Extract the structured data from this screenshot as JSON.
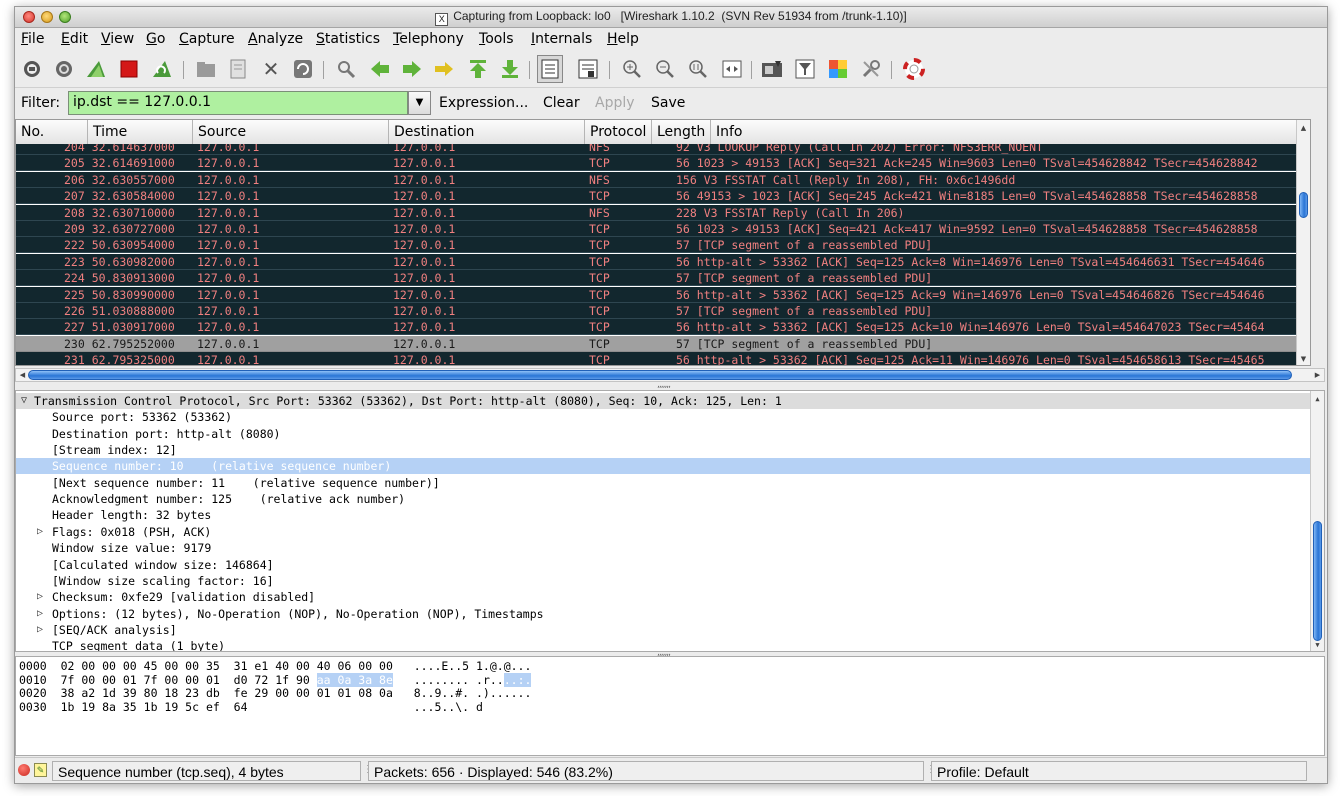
{
  "window": {
    "title": "Capturing from Loopback: lo0   [Wireshark 1.10.2  (SVN Rev 51934 from /trunk-1.10)]",
    "x11_glyph": "X"
  },
  "menu": [
    "File",
    "Edit",
    "View",
    "Go",
    "Capture",
    "Analyze",
    "Statistics",
    "Telephony",
    "Tools",
    "Internals",
    "Help"
  ],
  "toolbar": {
    "icons": [
      "interface-list-icon",
      "capture-options-icon",
      "start-capture-icon",
      "stop-capture-icon",
      "restart-capture-icon",
      "open-file-icon",
      "save-file-icon",
      "close-file-icon",
      "reload-icon",
      "find-packet-icon",
      "go-back-icon",
      "go-forward-icon",
      "go-to-packet-icon",
      "first-packet-icon",
      "last-packet-icon",
      "colorize-icon",
      "auto-scroll-icon",
      "zoom-in-icon",
      "zoom-out-icon",
      "normal-size-icon",
      "resize-columns-icon",
      "capture-filters-icon",
      "display-filters-icon",
      "coloring-rules-icon",
      "preferences-icon",
      "help-icon"
    ]
  },
  "filter": {
    "label": "Filter:",
    "value": "ip.dst == 127.0.0.1",
    "expression": "Expression...",
    "clear": "Clear",
    "apply": "Apply",
    "save": "Save"
  },
  "packet_list": {
    "columns": [
      "No.",
      "Time",
      "Source",
      "Destination",
      "Protocol",
      "Length",
      "Info"
    ],
    "rows": [
      {
        "no": "204",
        "time": "32.614637000",
        "src": "127.0.0.1",
        "dst": "127.0.0.1",
        "proto": "NFS",
        "len": "92",
        "info": "V3 LOOKUP Reply (Call In 202) Error: NFS3ERR_NOENT"
      },
      {
        "no": "205",
        "time": "32.614691000",
        "src": "127.0.0.1",
        "dst": "127.0.0.1",
        "proto": "TCP",
        "len": "56",
        "info": "1023 > 49153 [ACK] Seq=321 Ack=245 Win=9603 Len=0 TSval=454628842 TSecr=454628842"
      },
      {
        "no": "206",
        "time": "32.630557000",
        "src": "127.0.0.1",
        "dst": "127.0.0.1",
        "proto": "NFS",
        "len": "156",
        "info": "V3 FSSTAT Call (Reply In 208), FH: 0x6c1496dd"
      },
      {
        "no": "207",
        "time": "32.630584000",
        "src": "127.0.0.1",
        "dst": "127.0.0.1",
        "proto": "TCP",
        "len": "56",
        "info": "49153 > 1023 [ACK] Seq=245 Ack=421 Win=8185 Len=0 TSval=454628858 TSecr=454628858"
      },
      {
        "no": "208",
        "time": "32.630710000",
        "src": "127.0.0.1",
        "dst": "127.0.0.1",
        "proto": "NFS",
        "len": "228",
        "info": "V3 FSSTAT Reply (Call In 206)"
      },
      {
        "no": "209",
        "time": "32.630727000",
        "src": "127.0.0.1",
        "dst": "127.0.0.1",
        "proto": "TCP",
        "len": "56",
        "info": "1023 > 49153 [ACK] Seq=421 Ack=417 Win=9592 Len=0 TSval=454628858 TSecr=454628858"
      },
      {
        "no": "222",
        "time": "50.630954000",
        "src": "127.0.0.1",
        "dst": "127.0.0.1",
        "proto": "TCP",
        "len": "57",
        "info": "[TCP segment of a reassembled PDU]"
      },
      {
        "no": "223",
        "time": "50.630982000",
        "src": "127.0.0.1",
        "dst": "127.0.0.1",
        "proto": "TCP",
        "len": "56",
        "info": "http-alt > 53362 [ACK] Seq=125 Ack=8 Win=146976 Len=0 TSval=454646631 TSecr=454646"
      },
      {
        "no": "224",
        "time": "50.830913000",
        "src": "127.0.0.1",
        "dst": "127.0.0.1",
        "proto": "TCP",
        "len": "57",
        "info": "[TCP segment of a reassembled PDU]"
      },
      {
        "no": "225",
        "time": "50.830990000",
        "src": "127.0.0.1",
        "dst": "127.0.0.1",
        "proto": "TCP",
        "len": "56",
        "info": "http-alt > 53362 [ACK] Seq=125 Ack=9 Win=146976 Len=0 TSval=454646826 TSecr=454646"
      },
      {
        "no": "226",
        "time": "51.030888000",
        "src": "127.0.0.1",
        "dst": "127.0.0.1",
        "proto": "TCP",
        "len": "57",
        "info": "[TCP segment of a reassembled PDU]"
      },
      {
        "no": "227",
        "time": "51.030917000",
        "src": "127.0.0.1",
        "dst": "127.0.0.1",
        "proto": "TCP",
        "len": "56",
        "info": "http-alt > 53362 [ACK] Seq=125 Ack=10 Win=146976 Len=0 TSval=454647023 TSecr=45464"
      },
      {
        "no": "230",
        "time": "62.795252000",
        "src": "127.0.0.1",
        "dst": "127.0.0.1",
        "proto": "TCP",
        "len": "57",
        "info": "[TCP segment of a reassembled PDU]",
        "selected": true
      },
      {
        "no": "231",
        "time": "62.795325000",
        "src": "127.0.0.1",
        "dst": "127.0.0.1",
        "proto": "TCP",
        "len": "56",
        "info": "http-alt > 53362 [ACK] Seq=125 Ack=11 Win=146976 Len=0 TSval=454658613 TSecr=45465"
      }
    ]
  },
  "details": [
    {
      "text": "Transmission Control Protocol, Src Port: 53362 (53362), Dst Port: http-alt (8080), Seq: 10, Ack: 125, Len: 1",
      "indent": 0,
      "expander": "open"
    },
    {
      "text": "Source port: 53362 (53362)",
      "indent": 1
    },
    {
      "text": "Destination port: http-alt (8080)",
      "indent": 1
    },
    {
      "text": "[Stream index: 12]",
      "indent": 1
    },
    {
      "text": "Sequence number: 10    (relative sequence number)",
      "indent": 1,
      "selected": true
    },
    {
      "text": "[Next sequence number: 11    (relative sequence number)]",
      "indent": 1
    },
    {
      "text": "Acknowledgment number: 125    (relative ack number)",
      "indent": 1
    },
    {
      "text": "Header length: 32 bytes",
      "indent": 1
    },
    {
      "text": "Flags: 0x018 (PSH, ACK)",
      "indent": 1,
      "expander": "closed"
    },
    {
      "text": "Window size value: 9179",
      "indent": 1
    },
    {
      "text": "[Calculated window size: 146864]",
      "indent": 1
    },
    {
      "text": "[Window size scaling factor: 16]",
      "indent": 1
    },
    {
      "text": "Checksum: 0xfe29 [validation disabled]",
      "indent": 1,
      "expander": "closed"
    },
    {
      "text": "Options: (12 bytes), No-Operation (NOP), No-Operation (NOP), Timestamps",
      "indent": 1,
      "expander": "closed"
    },
    {
      "text": "[SEQ/ACK analysis]",
      "indent": 1,
      "expander": "closed"
    },
    {
      "text": "TCP segment data (1 byte)",
      "indent": 1
    }
  ],
  "hex": [
    {
      "offset": "0000",
      "pre": "02 00 00 00 45 00 00 35  31 e1 40 00 40 06 00 00",
      "hl": "",
      "post": "",
      "ascii_pre": "....E..5 1.@.@...",
      "ascii_hl": "",
      "ascii_post": ""
    },
    {
      "offset": "0010",
      "pre": "7f 00 00 01 7f 00 00 01  d0 72 1f 90 ",
      "hl": "aa 0a 3a 8e",
      "post": "",
      "ascii_pre": "........ .r..",
      "ascii_hl": "..:.",
      "ascii_post": ""
    },
    {
      "offset": "0020",
      "pre": "38 a2 1d 39 80 18 23 db  fe 29 00 00 01 01 08 0a",
      "hl": "",
      "post": "",
      "ascii_pre": "8..9..#. .)......",
      "ascii_hl": "",
      "ascii_post": ""
    },
    {
      "offset": "0030",
      "pre": "1b 19 8a 35 1b 19 5c ef  64",
      "hl": "",
      "post": "",
      "ascii_pre": "...5..\\. d",
      "ascii_hl": "",
      "ascii_post": ""
    }
  ],
  "status": {
    "field": "Sequence number (tcp.seq), 4 bytes",
    "packets": "Packets: 656 · Displayed: 546 (83.2%)",
    "profile": "Profile: Default"
  }
}
